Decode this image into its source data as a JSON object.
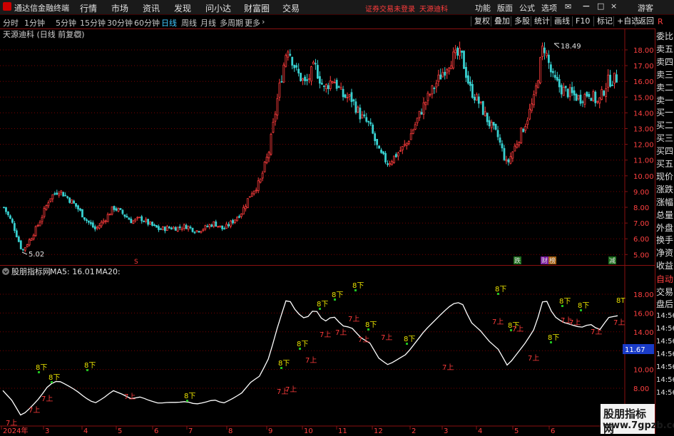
{
  "titlebar": {
    "app_name": "通达信金融终端",
    "menu": [
      "行情",
      "市场",
      "资讯",
      "发现",
      "问小达",
      "财富圈",
      "交易"
    ],
    "notice": "证券交易未登录",
    "stock_name": "天源迪科",
    "right_menu": [
      "功能",
      "版面",
      "公式",
      "选项"
    ],
    "user": "游客"
  },
  "periods": [
    "分时",
    "1分钟",
    "5分钟",
    "15分钟",
    "30分钟",
    "60分钟",
    "日线",
    "周线",
    "月线",
    "多周期",
    "更多"
  ],
  "active_period": "日线",
  "toolbar_buttons": [
    "复权",
    "叠加",
    "多股",
    "统计",
    "画线",
    "F10",
    "标记",
    "+自选",
    "返回"
  ],
  "main_chart": {
    "label": "天源迪科 (日线 前复权)",
    "high_label": "18.49",
    "low_label": "5.02",
    "y_ticks": [
      "18.00",
      "17.00",
      "16.00",
      "15.00",
      "14.00",
      "13.00",
      "12.00",
      "11.00",
      "10.00",
      "9.00",
      "8.00",
      "7.00",
      "6.00",
      "5.00"
    ],
    "event_marks": [
      "跌",
      "财",
      "榜",
      "减"
    ],
    "colors": {
      "up": "#ff3c3c",
      "down": "#38d0d0",
      "grid": "#7a0000"
    }
  },
  "indicator": {
    "name": "股朋指标网",
    "ma5_label": "MA5: 16.01",
    "ma20_label": "MA20:",
    "y_ticks": [
      "18.00",
      "16.00",
      "14.00",
      "12.00",
      "10.00",
      "8.00"
    ],
    "current_value": "11.67",
    "sell_label": "8下",
    "buy_label": "7上",
    "last_label": "8T"
  },
  "x_axis": {
    "labels": [
      "2024年",
      "3",
      "4",
      "5",
      "6",
      "7",
      "8",
      "9",
      "10",
      "11",
      "12",
      "2",
      "3",
      "4",
      "5",
      "6"
    ]
  },
  "right_panel": {
    "items": [
      "委比",
      "卖五",
      "卖四",
      "卖三",
      "卖二",
      "卖一",
      "买一",
      "买二",
      "买三",
      "买四",
      "买五",
      "现价",
      "涨跌",
      "涨幅",
      "总量",
      "外盘",
      "换手",
      "净资",
      "收益"
    ],
    "lower_items": [
      "自动",
      "交易",
      "盘后"
    ],
    "times": [
      "14:56",
      "14:56",
      "14:56",
      "14:56",
      "14:56",
      "14:56",
      "14:56"
    ]
  },
  "watermark": {
    "line1": "股朋指标网",
    "line2": "www.7gpzb.com"
  },
  "chart_data": {
    "type": "candlestick",
    "title": "天源迪科 (日线 前复权)",
    "ylim": [
      5,
      18.6
    ],
    "closes_sample": [
      8.0,
      6.9,
      5.2,
      6.1,
      7.2,
      8.6,
      9.1,
      8.6,
      8.0,
      7.2,
      6.6,
      7.2,
      8.0,
      7.6,
      7.1,
      7.3,
      6.9,
      6.6,
      6.7,
      6.7,
      6.8,
      6.5,
      6.7,
      7.0,
      6.6,
      7.1,
      7.7,
      8.9,
      9.6,
      11.6,
      15.2,
      18.3,
      16.6,
      15.8,
      17.0,
      15.5,
      16.2,
      15.1,
      14.9,
      13.8,
      13.2,
      11.5,
      10.8,
      11.4,
      12.0,
      13.3,
      14.6,
      15.6,
      16.6,
      17.5,
      17.7,
      15.5,
      14.6,
      13.4,
      12.5,
      10.7,
      12.0,
      13.3,
      14.9,
      18.4,
      16.2,
      15.5,
      15.2,
      14.9,
      15.3,
      14.6,
      16.0,
      16.2
    ]
  }
}
